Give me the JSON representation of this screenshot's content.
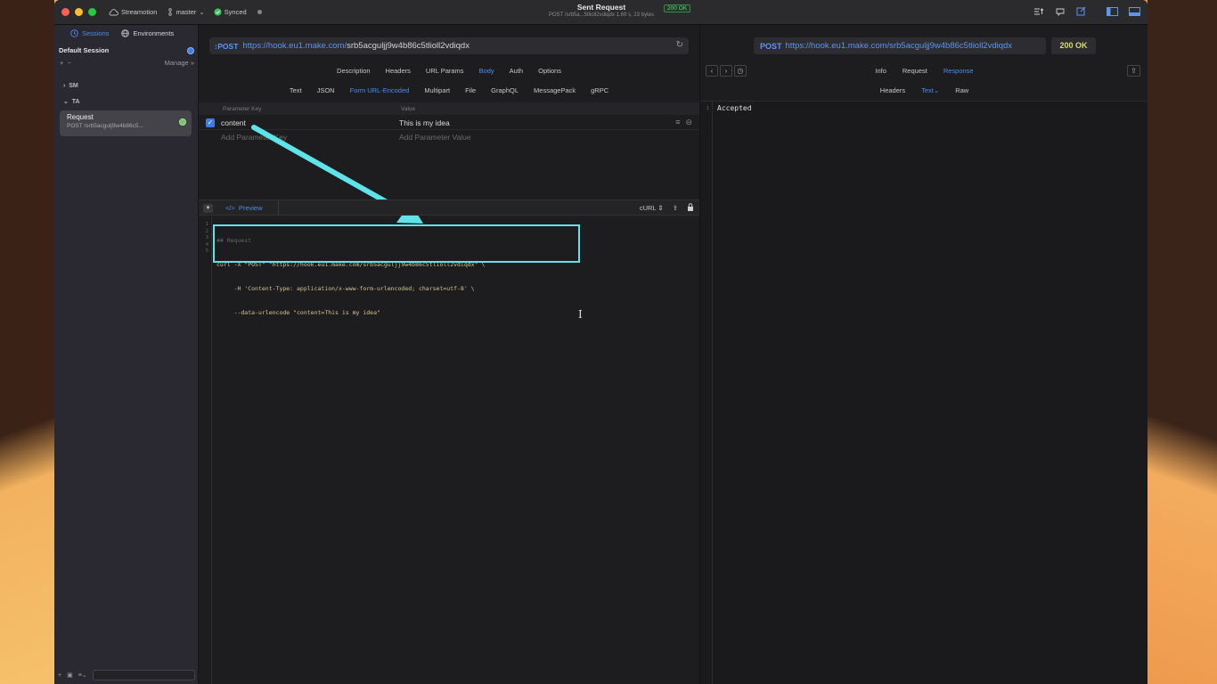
{
  "titlebar": {
    "project": "Streamotion",
    "branch": "master",
    "sync_status": "Synced",
    "window_title": "Sent Request",
    "window_subtitle": "POST /srb5a...5tlioll2vdiqdx  1.69 s, 23 bytes",
    "status_badge": "200 OK"
  },
  "sidebar": {
    "tabs": [
      {
        "label": "Sessions",
        "icon": "clock-icon"
      },
      {
        "label": "Environments",
        "icon": "globe-icon"
      }
    ],
    "session_name": "Default Session",
    "manage_label": "Manage",
    "groups": [
      "SM",
      "TA"
    ],
    "request": {
      "title": "Request",
      "subtitle": "POST /srb5acgulj9w4b86c5..."
    }
  },
  "request": {
    "method": "POST",
    "url_host": "https://hook.eu1.make.com/",
    "url_path": "srb5acguljj9w4b86c5tlioll2vdiqdx",
    "tabs": [
      "Description",
      "Headers",
      "URL Params",
      "Body",
      "Auth",
      "Options"
    ],
    "active_tab": "Body",
    "body_tabs": [
      "Text",
      "JSON",
      "Form URL-Encoded",
      "Multipart",
      "File",
      "GraphQL",
      "MessagePack",
      "gRPC"
    ],
    "active_body_tab": "Form URL-Encoded",
    "params_header": {
      "key": "Parameter Key",
      "value": "Value"
    },
    "params": [
      {
        "key": "content",
        "value": "This is my idea"
      }
    ],
    "add_key_placeholder": "Add Parameter Key",
    "add_value_placeholder": "Add Parameter Value"
  },
  "code_panel": {
    "preview_label": "Preview",
    "format_label": "cURL",
    "line_numbers": [
      "1",
      "2",
      "3",
      "4",
      "5"
    ],
    "lines": [
      "## Request",
      "curl -X \"POST\" \"https://hook.eu1.make.com/srb5acguljj9w4b86c5tlioll2vdiqdx\" \\",
      "     -H 'Content-Type: application/x-www-form-urlencoded; charset=utf-8' \\",
      "     --data-urlencode \"content=This is my idea\"",
      ""
    ]
  },
  "response": {
    "method": "POST",
    "url": "https://hook.eu1.make.com/srb5acguljj9w4b86c5tlioll2vdiqdx",
    "status": "200 OK",
    "tabs": [
      "Info",
      "Request",
      "Response"
    ],
    "active_tab": "Response",
    "sub_tabs": [
      "Headers",
      "Text",
      "Raw"
    ],
    "active_sub_tab": "Text",
    "line_number": "1",
    "body": "Accepted"
  },
  "colors": {
    "accent": "#4a8ef0",
    "highlight": "#5fe2e8",
    "status_ok": "#d7dc6e"
  }
}
